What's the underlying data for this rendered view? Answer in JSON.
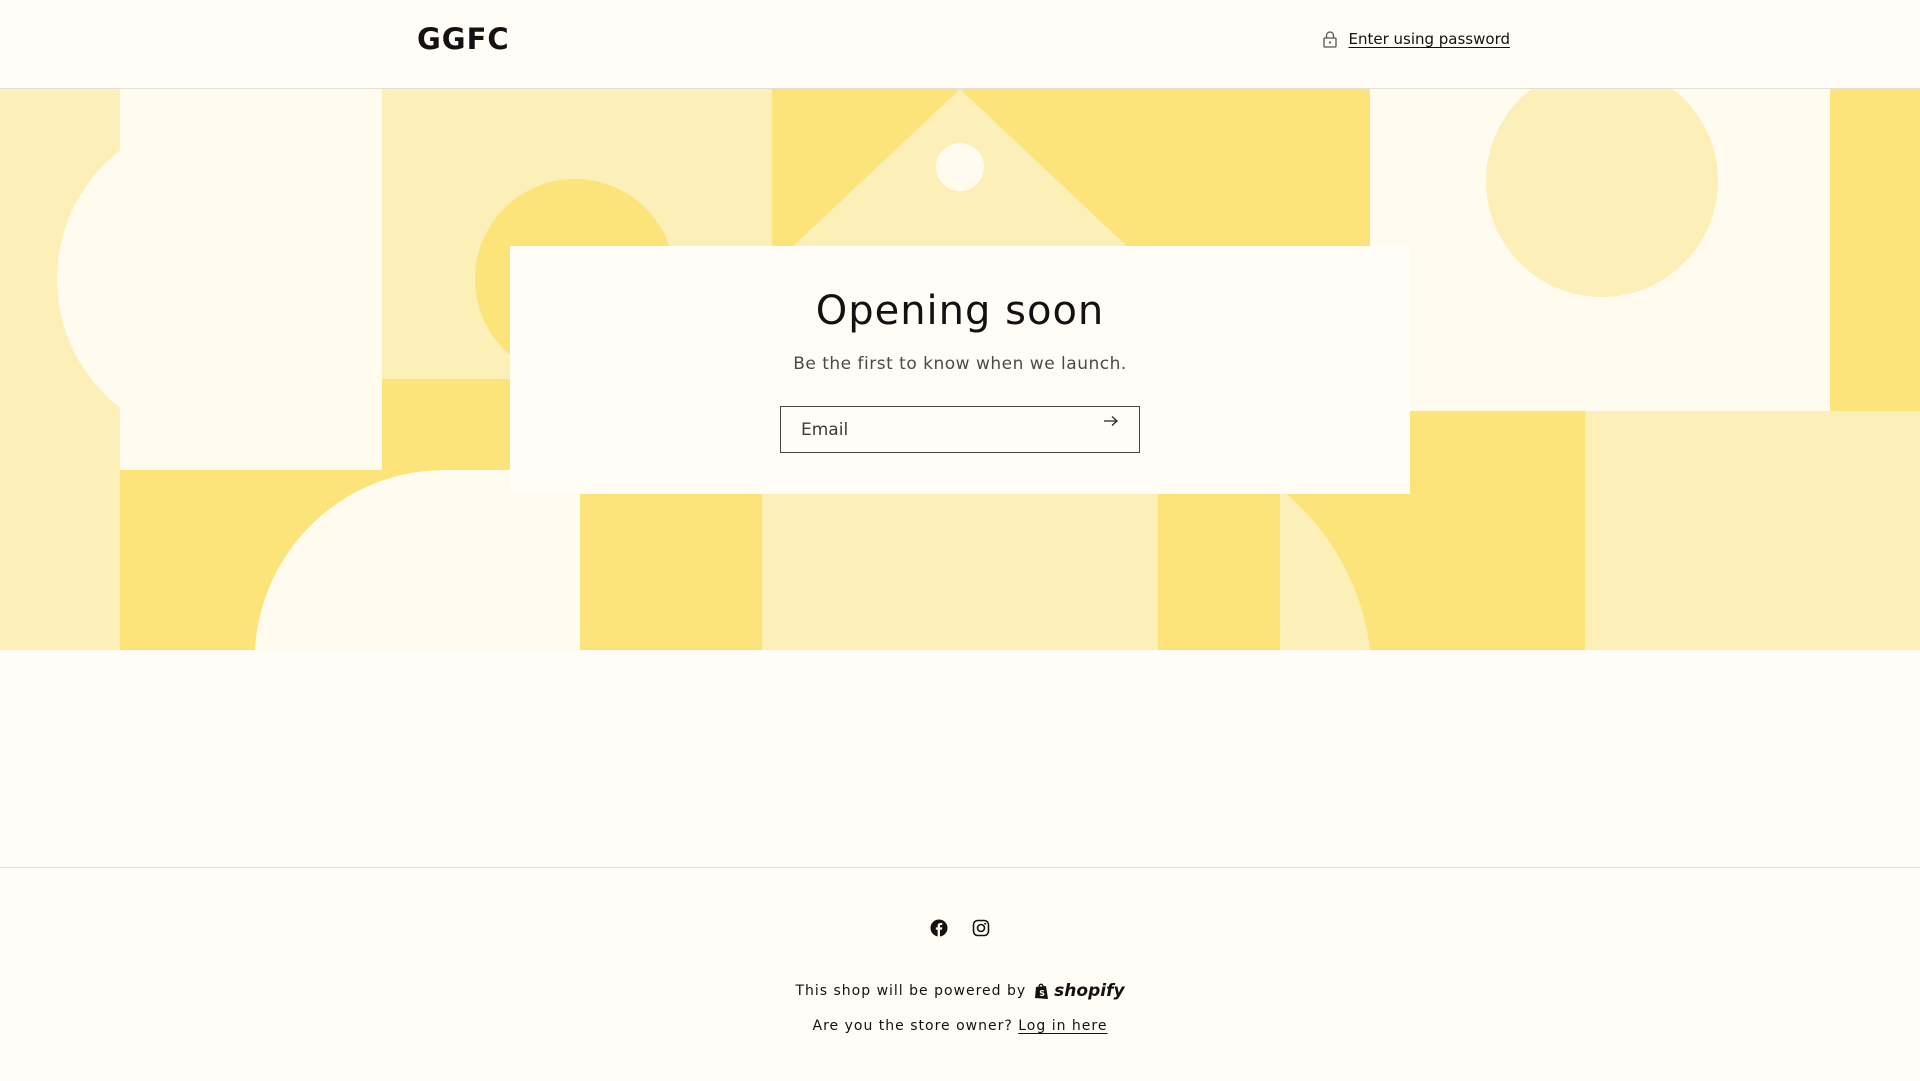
{
  "header": {
    "logo_text": "GGFC",
    "password_link": "Enter using password"
  },
  "banner": {
    "colors": {
      "light": "#fcefb7",
      "mid": "#fce47a",
      "pale": "#fffbee"
    }
  },
  "card": {
    "title": "Opening soon",
    "subtitle": "Be the first to know when we launch.",
    "email_placeholder": "Email",
    "email_value": ""
  },
  "footer": {
    "social": [
      "facebook-icon",
      "instagram-icon"
    ],
    "powered_text": "This shop will be powered by",
    "shopify_word": "shopify",
    "owner_prompt": "Are you the store owner?",
    "login_link": "Log in here"
  }
}
